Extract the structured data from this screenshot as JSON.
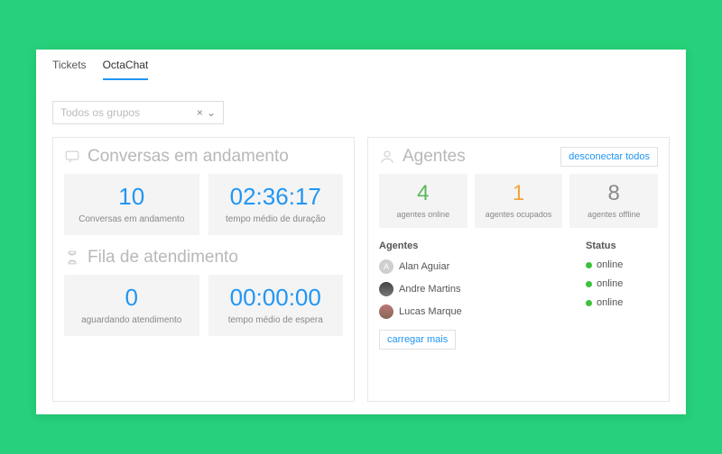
{
  "tabs": {
    "tickets": "Tickets",
    "octachat": "OctaChat"
  },
  "filter": {
    "placeholder": "Todos os grupos"
  },
  "conversations": {
    "title": "Conversas em andamento",
    "count": {
      "value": "10",
      "label": "Conversas em andamento"
    },
    "duration": {
      "value": "02:36:17",
      "label": "tempo médio de duração"
    }
  },
  "queue": {
    "title": "Fila de atendimento",
    "waiting": {
      "value": "0",
      "label": "aguardando atendimento"
    },
    "wait_time": {
      "value": "00:00:00",
      "label": "tempo médio de espera"
    }
  },
  "agents_panel": {
    "title": "Agentes",
    "disconnect_all": "desconectar todos",
    "online": {
      "value": "4",
      "label": "agentes online"
    },
    "busy": {
      "value": "1",
      "label": "agentes ocupados"
    },
    "offline": {
      "value": "8",
      "label": "agentes offline"
    },
    "table": {
      "col_agents": "Agentes",
      "col_status": "Status",
      "rows": [
        {
          "name": "Alan Aguiar",
          "status": "online"
        },
        {
          "name": "Andre Martins",
          "status": "online"
        },
        {
          "name": "Lucas Marque",
          "status": "online"
        }
      ]
    },
    "load_more": "carregar mais"
  }
}
